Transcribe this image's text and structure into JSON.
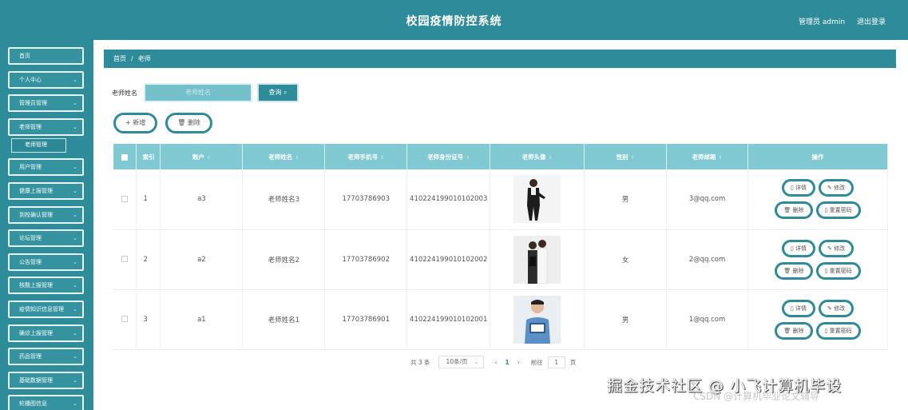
{
  "header": {
    "title": "校园疫情防控系统",
    "user": "管理员 admin",
    "logout": "退出登录"
  },
  "sidebar": {
    "items": [
      {
        "label": "首页",
        "has_arrow": false
      },
      {
        "label": "个人中心",
        "has_arrow": true
      },
      {
        "label": "管理员管理",
        "has_arrow": true
      },
      {
        "label": "老师管理",
        "has_arrow": true
      }
    ],
    "sub": "老师管理",
    "items2": [
      {
        "label": "用户管理"
      },
      {
        "label": "健康上报管理"
      },
      {
        "label": "到校确认管理"
      },
      {
        "label": "论坛管理"
      },
      {
        "label": "公告管理"
      },
      {
        "label": "核酸上报管理"
      },
      {
        "label": "疫情知识信息管理"
      },
      {
        "label": "确诊上报管理"
      },
      {
        "label": "药品管理"
      },
      {
        "label": "基础数据管理"
      },
      {
        "label": "轮播图信息"
      }
    ]
  },
  "breadcrumb": {
    "home": "首页",
    "sep": "/",
    "current": "老师"
  },
  "search": {
    "label": "老师姓名",
    "placeholder": "老师姓名",
    "button": "查询"
  },
  "actions": {
    "add": "新增",
    "delete": "删除"
  },
  "table": {
    "columns": [
      "索引",
      "账户",
      "老师姓名",
      "老师手机号",
      "老师身份证号",
      "老师头像",
      "性别",
      "老师邮箱",
      "操作"
    ],
    "rows": [
      {
        "index": "1",
        "account": "a3",
        "name": "老师姓名3",
        "phone": "17703786903",
        "idcard": "410224199010102003",
        "gender": "男",
        "email": "3@qq.com"
      },
      {
        "index": "2",
        "account": "a2",
        "name": "老师姓名2",
        "phone": "17703786902",
        "idcard": "410224199010102002",
        "gender": "女",
        "email": "2@qq.com"
      },
      {
        "index": "3",
        "account": "a1",
        "name": "老师姓名1",
        "phone": "17703786901",
        "idcard": "410224199010102001",
        "gender": "男",
        "email": "1@qq.com"
      }
    ],
    "ops": {
      "detail": "详情",
      "edit": "修改",
      "delete": "删除",
      "reset": "重置密码"
    }
  },
  "pager": {
    "total": "共 3 条",
    "size": "10条/页",
    "page": "1",
    "goto": "前往",
    "goto_value": "1",
    "page_unit": "页"
  },
  "watermark": {
    "main": "掘金技术社区 @ 小飞计算机毕设",
    "sub": "CSDN @计算机毕业论文辅导"
  },
  "colors": {
    "primary": "#2e8b99",
    "header_row": "#80c8d2"
  }
}
